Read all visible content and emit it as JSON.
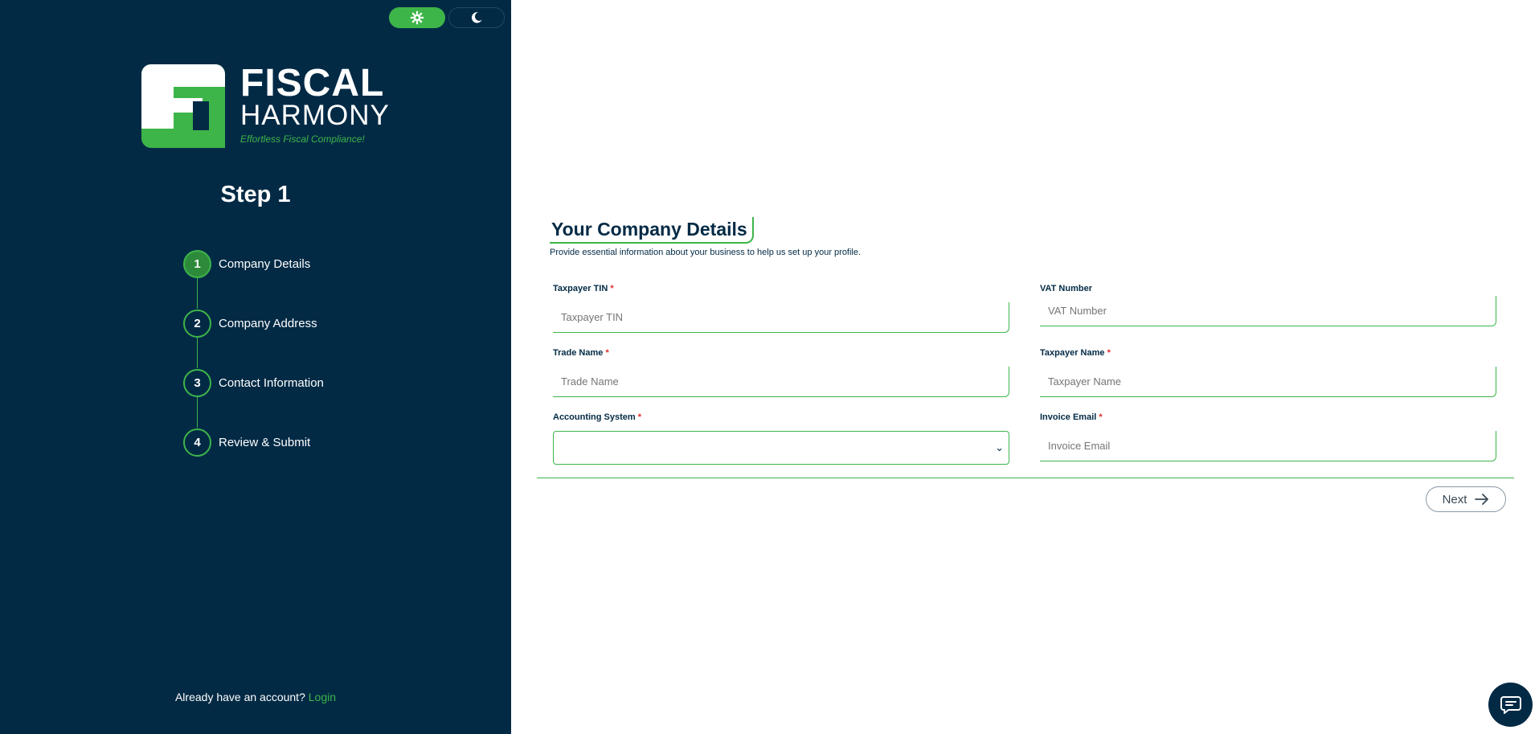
{
  "theme": {
    "light_icon": "sun-gear-icon",
    "dark_icon": "moon-icon"
  },
  "logo": {
    "line1": "FISCAL",
    "line2": "HARMONY",
    "tagline": "Effortless Fiscal Compliance!"
  },
  "sidebar": {
    "step_title": "Step 1",
    "steps": [
      {
        "number": "1",
        "label": "Company Details"
      },
      {
        "number": "2",
        "label": "Company Address"
      },
      {
        "number": "3",
        "label": "Contact Information"
      },
      {
        "number": "4",
        "label": "Review & Submit"
      }
    ],
    "account_text": "Already have an account?",
    "login_label": "Login"
  },
  "main": {
    "title": "Your Company Details",
    "subtitle": "Provide essential information about your business to help us set up your profile.",
    "fields": {
      "taxpayer_tin": {
        "label": "Taxpayer TIN",
        "required": "*",
        "placeholder": "Taxpayer TIN"
      },
      "vat_number": {
        "label": "VAT Number",
        "placeholder": "VAT Number"
      },
      "trade_name": {
        "label": "Trade Name",
        "required": "*",
        "placeholder": "Trade Name"
      },
      "taxpayer_name": {
        "label": "Taxpayer Name",
        "required": "*",
        "placeholder": "Taxpayer Name"
      },
      "accounting_system": {
        "label": "Accounting System",
        "required": "*",
        "value": ""
      },
      "invoice_email": {
        "label": "Invoice Email",
        "required": "*",
        "placeholder": "Invoice Email"
      }
    },
    "next_label": "Next"
  },
  "colors": {
    "sidebar_bg": "#022a45",
    "accent": "#3db549",
    "required": "#e02b2b"
  }
}
